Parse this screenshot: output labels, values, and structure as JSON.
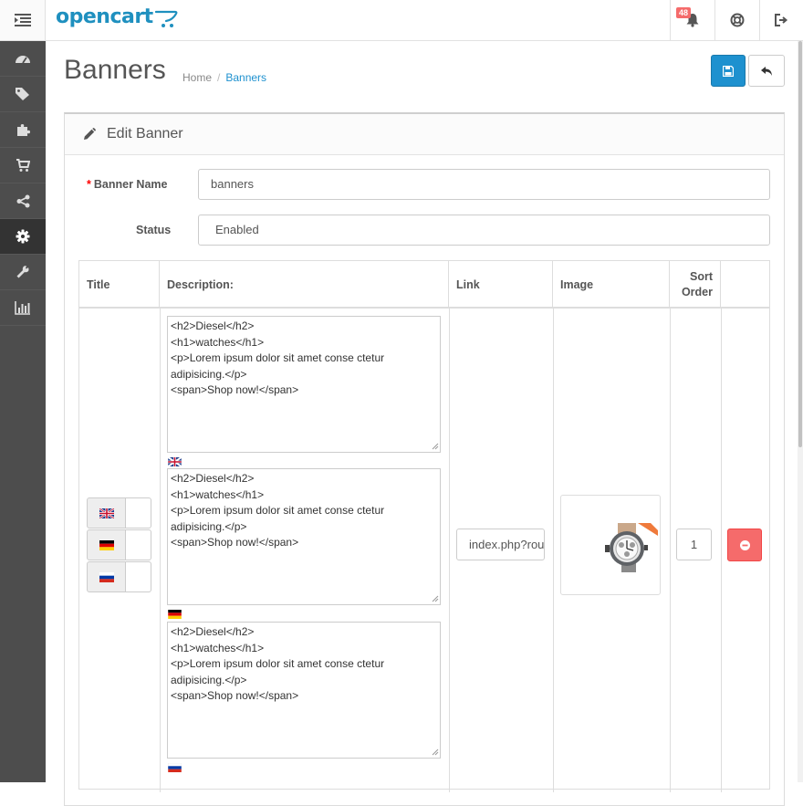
{
  "header": {
    "logo_text": "opencart",
    "notification_count": "48",
    "colors": {
      "brand": "#1f90bf",
      "sidebar": "#4d4d4d",
      "primary": "#1e91cf",
      "danger": "#f56b6b"
    }
  },
  "sidebar": {
    "items": [
      {
        "icon": "dashboard-icon"
      },
      {
        "icon": "tags-icon"
      },
      {
        "icon": "puzzle-icon"
      },
      {
        "icon": "cart-icon"
      },
      {
        "icon": "share-icon"
      },
      {
        "icon": "gear-icon",
        "active": true
      },
      {
        "icon": "wrench-icon"
      },
      {
        "icon": "bar-chart-icon"
      }
    ]
  },
  "page": {
    "title": "Banners",
    "breadcrumb": {
      "home": "Home",
      "current": "Banners"
    }
  },
  "panel": {
    "heading": "Edit Banner",
    "banner_name_label": "Banner Name",
    "banner_name_value": "banners",
    "status_label": "Status",
    "status_value": "Enabled"
  },
  "table": {
    "headers": {
      "title": "Title",
      "description": "Description:",
      "link": "Link",
      "image": "Image",
      "sort_order_line1": "Sort",
      "sort_order_line2": "Order"
    },
    "row": {
      "descriptions": [
        {
          "text": "<h2>Diesel</h2>\n<h1>watches</h1>\n<p>Lorem ipsum dolor sit amet conse ctetur adipisicing.</p>\n<span>Shop now!</span>",
          "language": "en"
        },
        {
          "text": "<h2>Diesel</h2>\n<h1>watches</h1>\n<p>Lorem ipsum dolor sit amet conse ctetur adipisicing.</p>\n<span>Shop now!</span>",
          "language": "de"
        },
        {
          "text": "<h2>Diesel</h2>\n<h1>watches</h1>\n<p>Lorem ipsum dolor sit amet conse ctetur adipisicing.</p>\n<span>Shop now!</span>",
          "language": "ru"
        }
      ],
      "link": "index.php?route",
      "sort_order": "1"
    }
  }
}
